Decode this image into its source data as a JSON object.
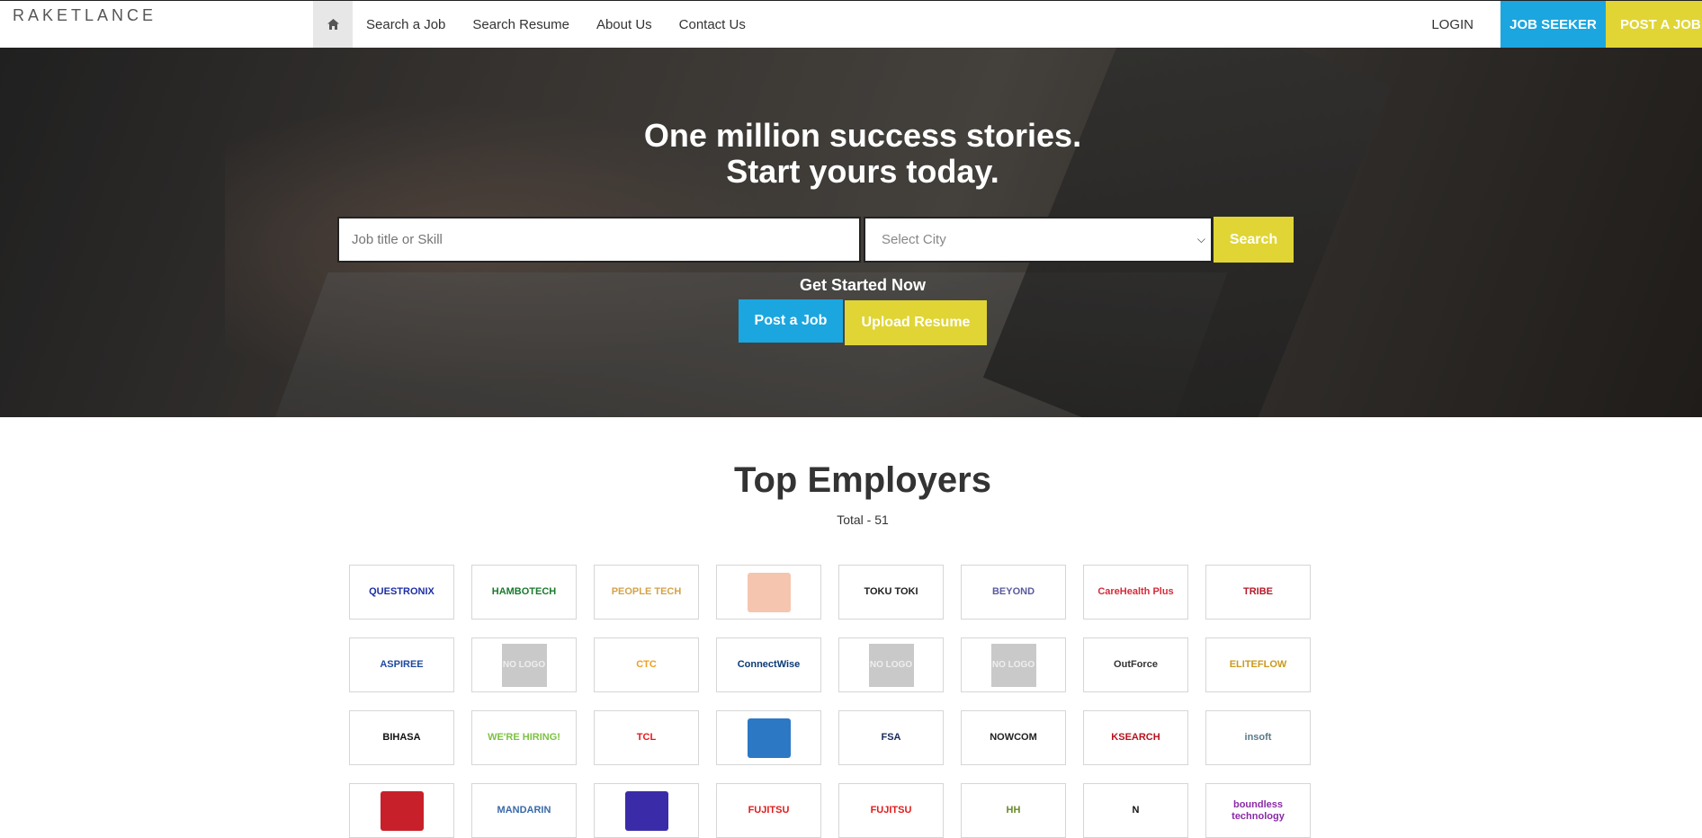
{
  "nav": {
    "brand": "RAKETLANCE",
    "links": [
      "Search a Job",
      "Search Resume",
      "About Us",
      "Contact Us"
    ],
    "login": "LOGIN",
    "job_seeker": "JOB SEEKER",
    "post_job": "POST A JOB"
  },
  "hero": {
    "title_line1": "One million success stories.",
    "title_line2": "Start yours today.",
    "search_placeholder": "Job title or Skill",
    "city_select": "Select City",
    "search_button": "Search",
    "get_started": "Get Started Now",
    "post_job_button": "Post a Job",
    "upload_resume_button": "Upload Resume"
  },
  "employers": {
    "title": "Top Employers",
    "total": "Total - 51",
    "logos": [
      {
        "text": "QUESTRONIX",
        "color": "#1d2fa5",
        "kind": "text"
      },
      {
        "text": "HAMBOTECH",
        "color": "#1a7a2e",
        "kind": "text"
      },
      {
        "text": "PEOPLE TECH",
        "color": "#d4a24a",
        "kind": "text"
      },
      {
        "text": "",
        "color": "#f5c5b0",
        "kind": "swatch"
      },
      {
        "text": "TOKU TOKI",
        "color": "#1e1e1e",
        "kind": "text"
      },
      {
        "text": "BEYOND",
        "color": "#5a5aa0",
        "kind": "text"
      },
      {
        "text": "CareHealth Plus",
        "color": "#d42c3a",
        "kind": "text"
      },
      {
        "text": "TRIBE",
        "color": "#b31b2a",
        "kind": "text"
      },
      {
        "text": "ASPIREE",
        "color": "#1f4aa0",
        "kind": "text"
      },
      {
        "text": "NO LOGO",
        "color": "#c9c9c9",
        "kind": "nologo"
      },
      {
        "text": "CTC",
        "color": "#f0a020",
        "kind": "text"
      },
      {
        "text": "ConnectWise",
        "color": "#0a3a78",
        "kind": "text"
      },
      {
        "text": "NO LOGO",
        "color": "#c9c9c9",
        "kind": "nologo"
      },
      {
        "text": "NO LOGO",
        "color": "#c9c9c9",
        "kind": "nologo"
      },
      {
        "text": "OutForce",
        "color": "#333333",
        "kind": "text"
      },
      {
        "text": "ELITEFLOW",
        "color": "#c99a1e",
        "kind": "text"
      },
      {
        "text": "BIHASA",
        "color": "#111111",
        "kind": "text"
      },
      {
        "text": "WE'RE HIRING!",
        "color": "#7cc242",
        "kind": "text"
      },
      {
        "text": "TCL",
        "color": "#e21b1b",
        "kind": "text"
      },
      {
        "text": "",
        "color": "#2d78c4",
        "kind": "swatch"
      },
      {
        "text": "FSA",
        "color": "#1a2a5a",
        "kind": "text"
      },
      {
        "text": "NOWCOM",
        "color": "#222222",
        "kind": "text"
      },
      {
        "text": "KSEARCH",
        "color": "#b8121e",
        "kind": "text"
      },
      {
        "text": "insoft",
        "color": "#5a7a8a",
        "kind": "text"
      },
      {
        "text": "",
        "color": "#c8202a",
        "kind": "swatch"
      },
      {
        "text": "MANDARIN",
        "color": "#3a6aa8",
        "kind": "text"
      },
      {
        "text": "",
        "color": "#3a2ca8",
        "kind": "swatch"
      },
      {
        "text": "FUJITSU",
        "color": "#e21b1b",
        "kind": "text"
      },
      {
        "text": "FUJITSU",
        "color": "#e21b1b",
        "kind": "text"
      },
      {
        "text": "HH",
        "color": "#6a8a2a",
        "kind": "text"
      },
      {
        "text": "N",
        "color": "#111111",
        "kind": "text"
      },
      {
        "text": "boundless technology",
        "color": "#8a2aa8",
        "kind": "text"
      }
    ]
  }
}
